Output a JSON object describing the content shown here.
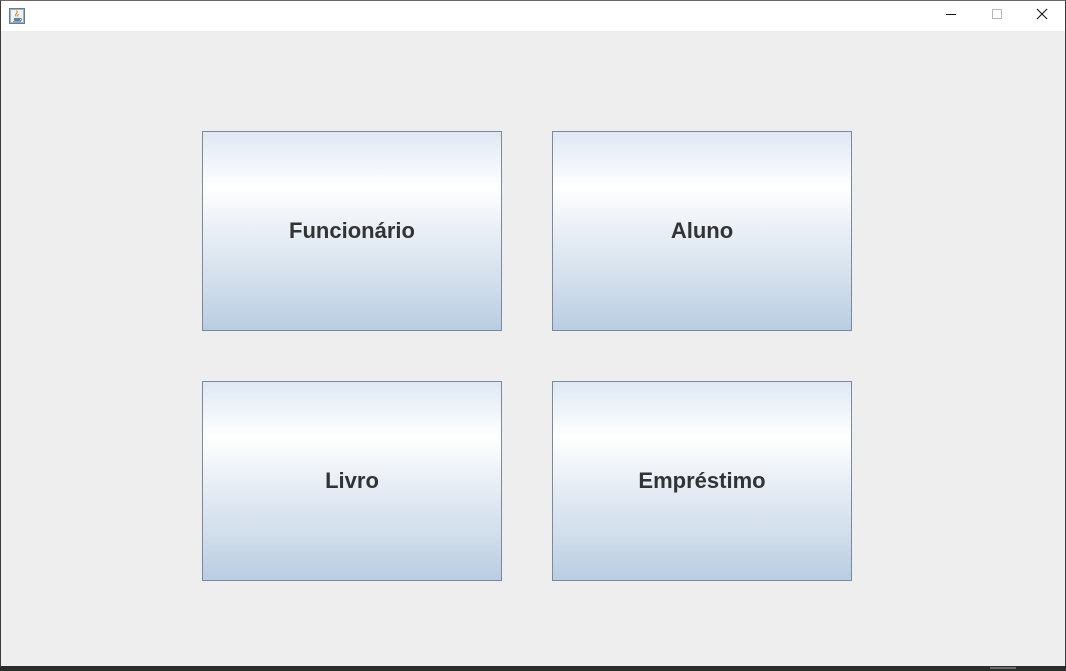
{
  "window": {
    "title": "",
    "icon": "java-cup-icon",
    "controls": {
      "minimize_icon": "minimize-icon",
      "maximize_icon": "maximize-icon",
      "close_icon": "close-icon"
    }
  },
  "menu": {
    "buttons": [
      {
        "label": "Funcionário"
      },
      {
        "label": "Aluno"
      },
      {
        "label": "Livro"
      },
      {
        "label": "Empréstimo"
      }
    ]
  },
  "colors": {
    "background": "#eeeeee",
    "button_border": "#7a8a9c",
    "button_text": "#333333",
    "button_gradient_top": "#ffffff",
    "button_gradient_bottom": "#b9cde3"
  }
}
